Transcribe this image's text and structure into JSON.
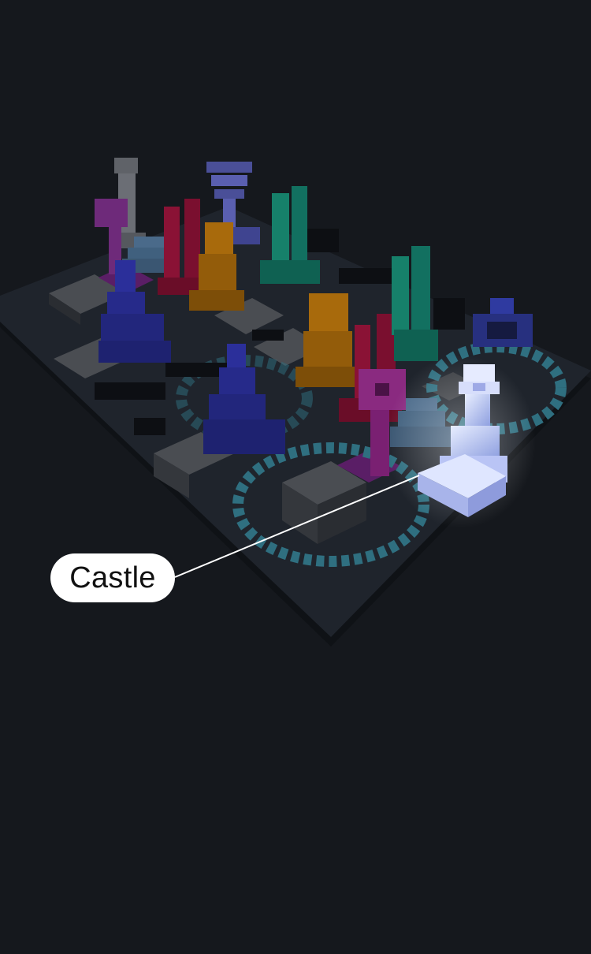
{
  "callout": {
    "label": "Castle"
  },
  "colors": {
    "background": "#15181d",
    "board": "#1e232b",
    "board_edge": "#0f1216",
    "tile_light": "#4a4d52",
    "tile_dark": "#23272e",
    "ring": "#2f6f80",
    "highlight_piece": "#c9d4ff",
    "pieces": [
      "#6b6e75",
      "#5a5fb0",
      "#6e2a7a",
      "#2b2f9a",
      "#8a1235",
      "#a86a0c",
      "#16806a",
      "#2f3aa0",
      "#8a2a80",
      "#4a6a8a"
    ]
  },
  "scene": {
    "pieces": [
      {
        "name": "gray-tower",
        "color": "#6b6e75"
      },
      {
        "name": "blue-lantern",
        "color": "#5a5fb0"
      },
      {
        "name": "purple-staff",
        "color": "#6e2a7a"
      },
      {
        "name": "blue-stack",
        "color": "#2b2f9a"
      },
      {
        "name": "crimson-pillars",
        "color": "#8a1235"
      },
      {
        "name": "amber-knight",
        "color": "#a86a0c"
      },
      {
        "name": "teal-pillars",
        "color": "#16806a"
      },
      {
        "name": "amber-knight-2",
        "color": "#a86a0c"
      },
      {
        "name": "crimson-pillars-2",
        "color": "#8a1235"
      },
      {
        "name": "teal-pillars-2",
        "color": "#16806a"
      },
      {
        "name": "indigo-lantern",
        "color": "#2f3aa0"
      },
      {
        "name": "blue-stack-2",
        "color": "#2b2f9a"
      },
      {
        "name": "purple-staff-2",
        "color": "#8a2a80"
      },
      {
        "name": "slate-pyramid",
        "color": "#4a6a8a"
      },
      {
        "name": "castle-piece",
        "color": "#c9d4ff"
      }
    ]
  }
}
